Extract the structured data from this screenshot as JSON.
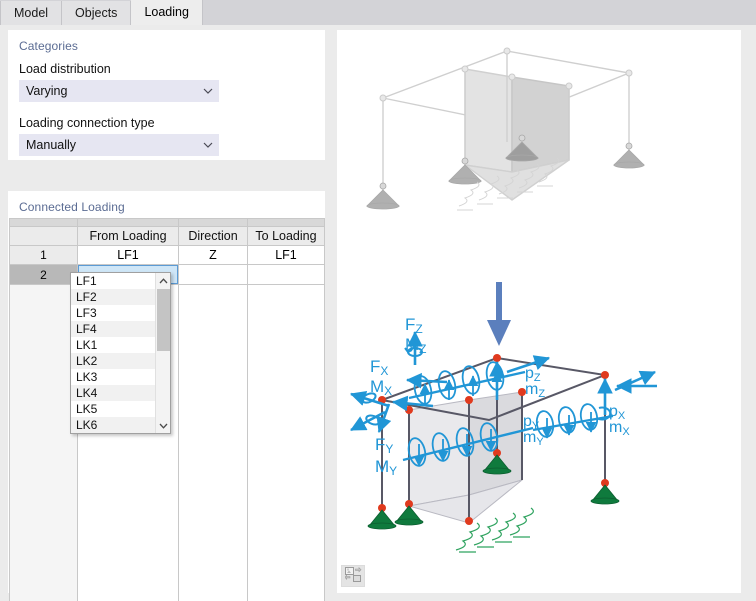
{
  "window": {
    "tabs": [
      {
        "label": "Model",
        "active": false
      },
      {
        "label": "Objects",
        "active": false
      },
      {
        "label": "Loading",
        "active": true
      }
    ]
  },
  "categories": {
    "title": "Categories",
    "load_distribution": {
      "label": "Load distribution",
      "value": "Varying",
      "options": [
        "Varying"
      ]
    },
    "loading_connection_type": {
      "label": "Loading connection type",
      "value": "Manually",
      "options": [
        "Manually"
      ]
    }
  },
  "connected_loading": {
    "title": "Connected Loading",
    "columns": [
      "",
      "From Loading",
      "Direction",
      "To Loading"
    ],
    "rows": [
      {
        "num": "1",
        "from": "LF1",
        "direction": "Z",
        "to": "LF1",
        "selected": false
      },
      {
        "num": "2",
        "from": "",
        "direction": "",
        "to": "",
        "selected": true
      }
    ],
    "editing_cell": {
      "row": "2",
      "column": "From Loading",
      "value": ""
    },
    "dropdown": {
      "open": true,
      "options": [
        "LF1",
        "LF2",
        "LF3",
        "LF4",
        "LK1",
        "LK2",
        "LK3",
        "LK4",
        "LK5",
        "LK6"
      ],
      "scroll_up_icon": "chevron-up-icon",
      "scroll_down_icon": "chevron-down-icon"
    }
  },
  "preview": {
    "top_figure": {
      "name": "structural-frame-ghost-diagram",
      "description": "Faded 3D frame with slab, point supports and spring supports"
    },
    "bottom_figure": {
      "name": "load-direction-diagram",
      "description": "3D frame with blue load arrows and green supports",
      "labels": [
        {
          "text": "F",
          "sub": "Z"
        },
        {
          "text": "M",
          "sub": "Z"
        },
        {
          "text": "F",
          "sub": "X"
        },
        {
          "text": "M",
          "sub": "X"
        },
        {
          "text": "F",
          "sub": "Y"
        },
        {
          "text": "M",
          "sub": "Y"
        },
        {
          "text": "p",
          "sub": "Z"
        },
        {
          "text": "m",
          "sub": "Z"
        },
        {
          "text": "p",
          "sub": "Y"
        },
        {
          "text": "m",
          "sub": "Y"
        },
        {
          "text": "p",
          "sub": "X"
        },
        {
          "text": "m",
          "sub": "X"
        }
      ]
    },
    "image_button": {
      "name": "insert-image-button",
      "icon": "picture-transfer-icon"
    }
  },
  "colors": {
    "accent_heading": "#5b6c93",
    "combo_fill": "#e6e6f2",
    "editing_cell_fill": "#cfe6f7",
    "editing_cell_border": "#5b9bd5",
    "load_arrow_blue": "#2196d6",
    "support_green": "#0f7a3d",
    "node_red": "#e03a1e",
    "frame_gray": "#585866"
  }
}
